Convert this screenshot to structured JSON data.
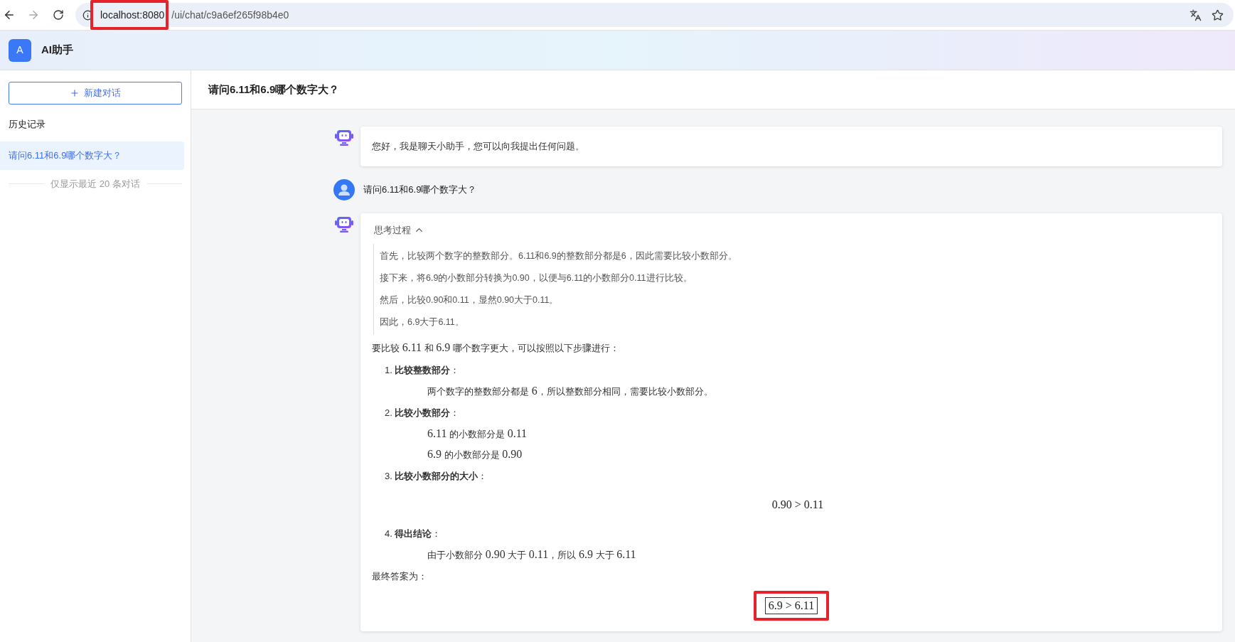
{
  "browser": {
    "forward_enabled": false,
    "url_host": "localhost:8080",
    "url_path": "/ui/chat/c9a6ef265f98b4e0",
    "host_highlighted": true
  },
  "app": {
    "logo_letter": "A",
    "title": "AI助手"
  },
  "sidebar": {
    "new_chat": "新建对话",
    "history_heading": "历史记录",
    "items": [
      {
        "label": "请问6.11和6.9哪个数字大？",
        "selected": true
      }
    ],
    "footer_note": "仅显示最近 20 条对话"
  },
  "chat": {
    "title": "请问6.11和6.9哪个数字大？",
    "messages": [
      {
        "kind": "bot_plain",
        "text": "您好，我是聊天小助手，您可以向我提出任何问题。"
      },
      {
        "kind": "user",
        "text": "请问6.11和6.9哪个数字大？"
      },
      {
        "kind": "bot_reasoning",
        "thinking": {
          "label": "思考过程",
          "expanded": true,
          "lines": [
            "首先，比较两个数字的整数部分。6.11和6.9的整数部分都是6，因此需要比较小数部分。",
            "接下来，将6.9的小数部分转换为0.90，以便与6.11的小数部分0.11进行比较。",
            "然后，比较0.90和0.11，显然0.90大于0.11。",
            "因此，6.9大于6.11。"
          ]
        },
        "answer": [
          {
            "kind": "paragraph",
            "parts": [
              {
                "kind": "text",
                "text": "要比较 "
              },
              {
                "kind": "math",
                "text": "6.11"
              },
              {
                "kind": "text",
                "text": " 和 "
              },
              {
                "kind": "math",
                "text": "6.9"
              },
              {
                "kind": "text",
                "text": " 哪个数字更大，可以按照以下步骤进行："
              }
            ]
          },
          {
            "kind": "step",
            "number": "1.",
            "heading": "**比较整数部分**：",
            "body": [
              {
                "kind": "line",
                "parts": [
                  {
                    "kind": "text",
                    "text": "两个数字的整数部分都是 "
                  },
                  {
                    "kind": "math",
                    "text": "6"
                  },
                  {
                    "kind": "text",
                    "text": "，所以整数部分相同，需要比较小数部分。"
                  }
                ]
              }
            ]
          },
          {
            "kind": "step",
            "number": "2.",
            "heading": "**比较小数部分**：",
            "body": [
              {
                "kind": "line",
                "parts": [
                  {
                    "kind": "math",
                    "text": "6.11"
                  },
                  {
                    "kind": "text",
                    "text": " 的小数部分是 "
                  },
                  {
                    "kind": "math",
                    "text": "0.11"
                  }
                ]
              },
              {
                "kind": "line",
                "parts": [
                  {
                    "kind": "math",
                    "text": "6.9"
                  },
                  {
                    "kind": "text",
                    "text": " 的小数部分是 "
                  },
                  {
                    "kind": "math",
                    "text": "0.90"
                  }
                ]
              }
            ]
          },
          {
            "kind": "step",
            "number": "3.",
            "heading": "**比较小数部分的大小**：",
            "body": [
              {
                "kind": "display_math",
                "text": "0.90 > 0.11",
                "boxed": false,
                "highlighted": false
              }
            ]
          },
          {
            "kind": "step",
            "number": "4.",
            "heading": "**得出结论**：",
            "body": [
              {
                "kind": "line",
                "parts": [
                  {
                    "kind": "text",
                    "text": "由于小数部分 "
                  },
                  {
                    "kind": "math",
                    "text": "0.90"
                  },
                  {
                    "kind": "text",
                    "text": " 大于 "
                  },
                  {
                    "kind": "math",
                    "text": "0.11"
                  },
                  {
                    "kind": "text",
                    "text": "，所以 "
                  },
                  {
                    "kind": "math",
                    "text": "6.9"
                  },
                  {
                    "kind": "text",
                    "text": " 大于 "
                  },
                  {
                    "kind": "math",
                    "text": "6.11"
                  }
                ]
              }
            ]
          },
          {
            "kind": "paragraph",
            "parts": [
              {
                "kind": "text",
                "text": "最终答案为："
              }
            ]
          },
          {
            "kind": "display_math",
            "text": "6.9 > 6.11",
            "boxed": true,
            "highlighted": true
          }
        ]
      }
    ]
  }
}
